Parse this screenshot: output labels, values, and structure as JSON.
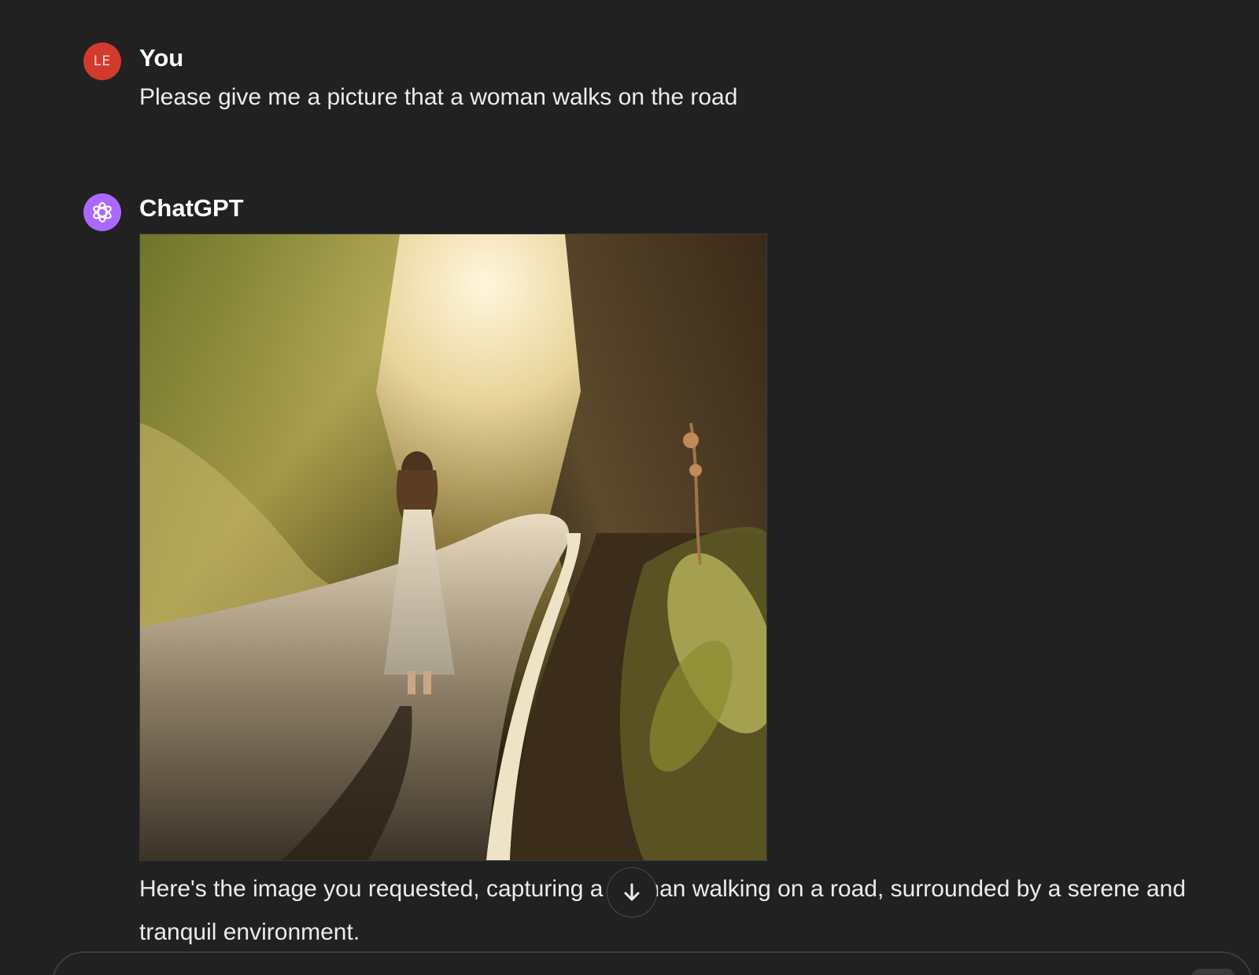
{
  "user_message": {
    "avatar_initials": "LE",
    "avatar_color": "#d23a2d",
    "author": "You",
    "text": "Please give me a picture that a woman walks on the road"
  },
  "assistant_message": {
    "avatar_icon": "openai-logo-icon",
    "avatar_color": "#ab68ff",
    "author": "ChatGPT",
    "image_icon": "generated-image",
    "text": "Here's the image you requested, capturing a woman walking on a road, surrounded by a serene and tranquil environment."
  },
  "scroll_down_icon": "arrow-down-icon",
  "composer": {
    "border_color": "#3d3d3d"
  },
  "theme": {
    "background": "#212121",
    "text": "#ececec"
  }
}
